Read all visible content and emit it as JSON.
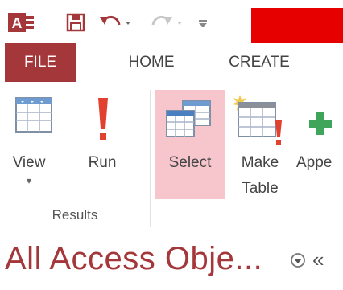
{
  "colors": {
    "access_red": "#a4373a",
    "highlight": "#f7c5cc",
    "redaction": "#e60000"
  },
  "quick_access": {
    "app_icon_text": "A",
    "save_icon": "save-icon",
    "undo_icon": "undo-icon",
    "redo_icon": "redo-icon",
    "customize_icon": "customize-qat-icon"
  },
  "tabs": [
    {
      "label": "FILE",
      "active": true
    },
    {
      "label": "HOME"
    },
    {
      "label": "CREATE"
    }
  ],
  "ribbon": {
    "results_group": {
      "label": "Results",
      "view": {
        "label": "View",
        "dropdown_glyph": "▾"
      },
      "run": {
        "label": "Run"
      }
    },
    "query_type_group": {
      "select": {
        "label": "Select",
        "selected": true
      },
      "make_table": {
        "label_line1": "Make",
        "label_line2": "Table"
      },
      "append": {
        "label": "Appe"
      }
    }
  },
  "nav_pane": {
    "title": "All Access Obje...",
    "collapse_glyph": "«"
  }
}
